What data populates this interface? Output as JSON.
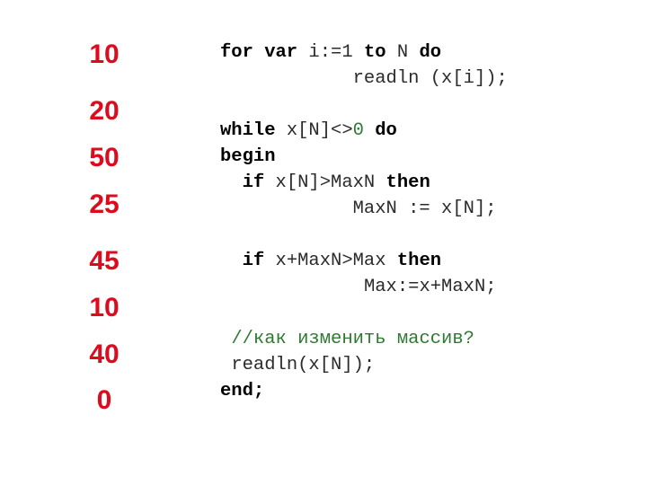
{
  "slide": {
    "background_color": "#ffffff",
    "array_value_color": "#DD0B1E",
    "code_color": "#2b2b2b",
    "keyword_color": "#000000",
    "comment_color": "#2E7A32"
  },
  "array_column": {
    "label": "array-values",
    "values": [
      "10",
      "20",
      "50",
      "25",
      "45",
      "10",
      "40",
      "0"
    ]
  },
  "code": {
    "lines": [
      {
        "id": "line-for",
        "indent": "",
        "tokens": [
          {
            "text": "for var ",
            "style": "kw"
          },
          {
            "text": "i:=1 ",
            "style": "plain"
          },
          {
            "text": "to ",
            "style": "kw"
          },
          {
            "text": "N ",
            "style": "plain"
          },
          {
            "text": "do",
            "style": "kw"
          }
        ]
      },
      {
        "id": "line-readln-i",
        "indent": "            ",
        "tokens": [
          {
            "text": "readln (x[i]);",
            "style": "plain"
          }
        ]
      },
      {
        "id": "line-blank-1",
        "indent": "",
        "tokens": []
      },
      {
        "id": "line-while",
        "indent": "",
        "tokens": [
          {
            "text": "while ",
            "style": "kw"
          },
          {
            "text": "x[N]<>",
            "style": "plain"
          },
          {
            "text": "0",
            "style": "num-green"
          },
          {
            "text": " do",
            "style": "kw"
          }
        ]
      },
      {
        "id": "line-begin",
        "indent": "",
        "tokens": [
          {
            "text": "begin",
            "style": "kw"
          }
        ]
      },
      {
        "id": "line-if-maxn",
        "indent": "  ",
        "tokens": [
          {
            "text": "if ",
            "style": "kw"
          },
          {
            "text": "x[N]>MaxN ",
            "style": "plain"
          },
          {
            "text": "then",
            "style": "kw"
          }
        ]
      },
      {
        "id": "line-assign-maxn",
        "indent": "            ",
        "tokens": [
          {
            "text": "MaxN := x[N];",
            "style": "plain"
          }
        ]
      },
      {
        "id": "line-blank-2",
        "indent": "",
        "tokens": []
      },
      {
        "id": "line-if-max",
        "indent": "  ",
        "tokens": [
          {
            "text": "if ",
            "style": "kw"
          },
          {
            "text": "x+MaxN>Max ",
            "style": "plain"
          },
          {
            "text": "then",
            "style": "kw"
          }
        ]
      },
      {
        "id": "line-assign-max",
        "indent": "             ",
        "tokens": [
          {
            "text": "Max:=x+MaxN;",
            "style": "plain"
          }
        ]
      },
      {
        "id": "line-blank-3",
        "indent": "",
        "tokens": []
      },
      {
        "id": "line-comment",
        "indent": " ",
        "tokens": [
          {
            "text": "//как изменить массив?",
            "style": "comment"
          }
        ]
      },
      {
        "id": "line-readln-n",
        "indent": " ",
        "tokens": [
          {
            "text": "readln(x[N]);",
            "style": "plain"
          }
        ]
      },
      {
        "id": "line-end",
        "indent": "",
        "tokens": [
          {
            "text": "end;",
            "style": "kw"
          }
        ]
      }
    ]
  }
}
